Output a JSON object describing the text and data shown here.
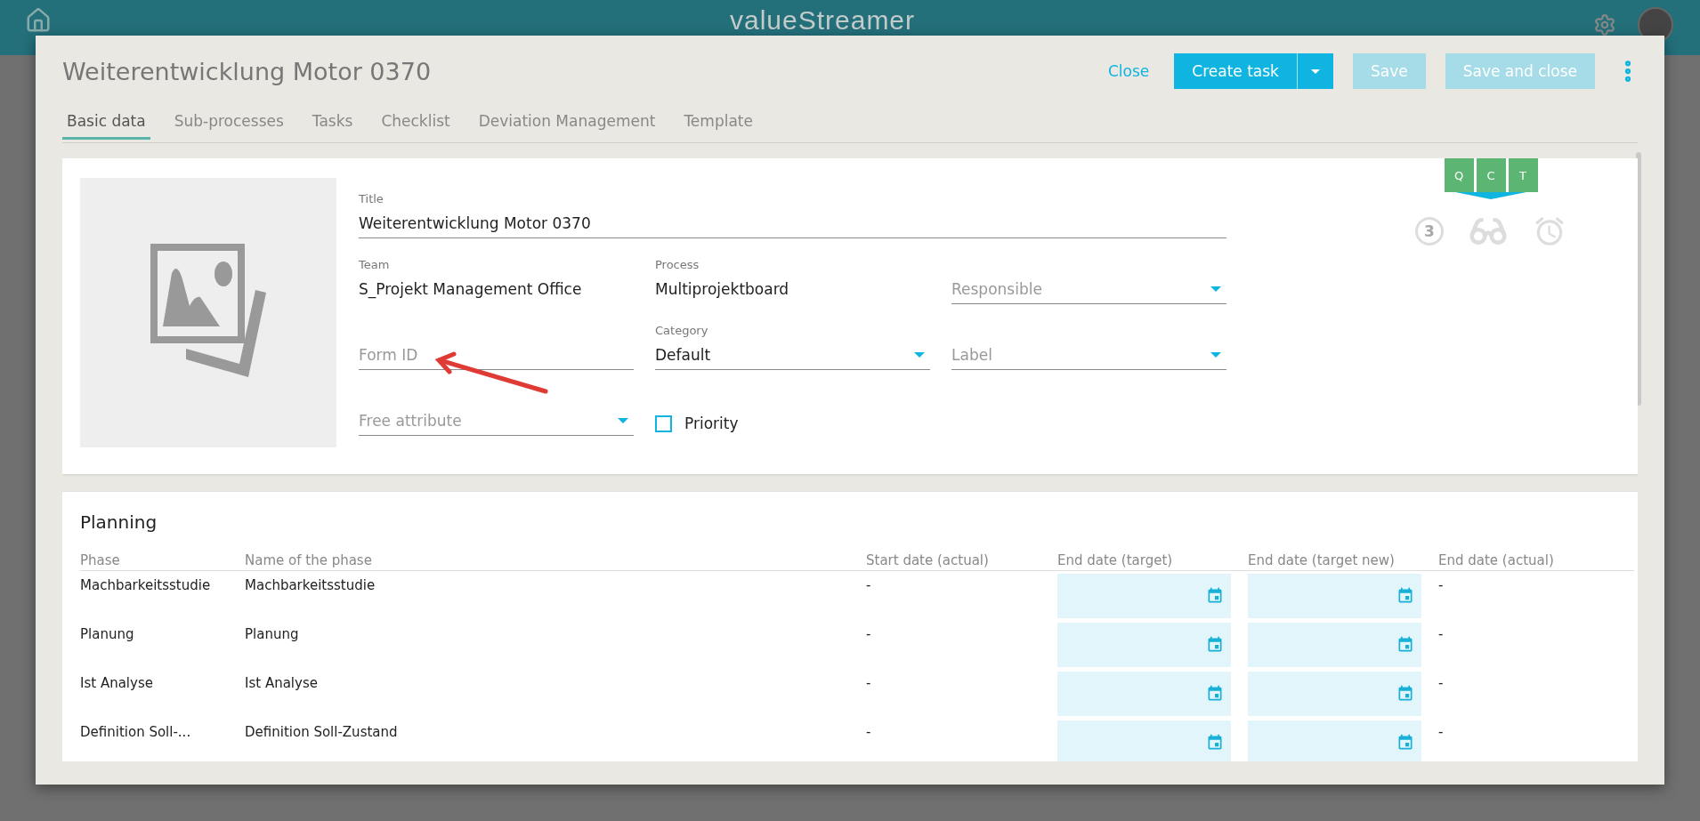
{
  "app_header": {
    "logo": "valueStreamer"
  },
  "dialog": {
    "title": "Weiterentwicklung Motor 0370",
    "actions": [
      {
        "label": "Close",
        "kind": "link",
        "disabled": false
      },
      {
        "label": "Create task",
        "kind": "split",
        "disabled": false
      },
      {
        "label": "Save",
        "kind": "primary",
        "disabled": true
      },
      {
        "label": "Save and close",
        "kind": "primary",
        "disabled": true
      }
    ]
  },
  "tabs": [
    {
      "label": "Basic data",
      "selected": true
    },
    {
      "label": "Sub-processes",
      "selected": false
    },
    {
      "label": "Tasks",
      "selected": false
    },
    {
      "label": "Checklist",
      "selected": false
    },
    {
      "label": "Deviation Management",
      "selected": false
    },
    {
      "label": "Template",
      "selected": false
    }
  ],
  "basic_data": {
    "fields": [
      {
        "kind": "input",
        "label": "Title",
        "value": "Weiterentwicklung Motor 0370"
      },
      {
        "kind": "static",
        "label": "Team",
        "value": "S_Projekt Management Office"
      },
      {
        "kind": "static",
        "label": "Process",
        "value": "Multiprojektboard"
      },
      {
        "kind": "select",
        "placeholder": "Responsible"
      },
      {
        "kind": "input",
        "placeholder": "Form ID"
      },
      {
        "kind": "select",
        "label": "Category",
        "value": "Default"
      },
      {
        "kind": "select",
        "placeholder": "Label"
      },
      {
        "kind": "select",
        "placeholder": "Free attribute"
      },
      {
        "kind": "checkbox",
        "label": "Priority",
        "checked": false
      }
    ],
    "badges": [
      "Q",
      "C",
      "T"
    ],
    "status": {
      "count": "3"
    }
  },
  "planning": {
    "title": "Planning",
    "columns": [
      "Phase",
      "Name of the phase",
      "Start date (actual)",
      "End date (target)",
      "End date (target new)",
      "End date (actual)"
    ],
    "rows": [
      {
        "phase": "Machbarkeitsstudie",
        "name": "Machbarkeitsstudie",
        "start_actual": "-",
        "end_actual": "-"
      },
      {
        "phase": "Planung",
        "name": "Planung",
        "start_actual": "-",
        "end_actual": "-"
      },
      {
        "phase": "Ist Analyse",
        "name": "Ist Analyse",
        "start_actual": "-",
        "end_actual": "-"
      },
      {
        "phase": "Definition Soll-...",
        "name": "Definition Soll-Zustand",
        "start_actual": "-",
        "end_actual": "-"
      }
    ]
  }
}
